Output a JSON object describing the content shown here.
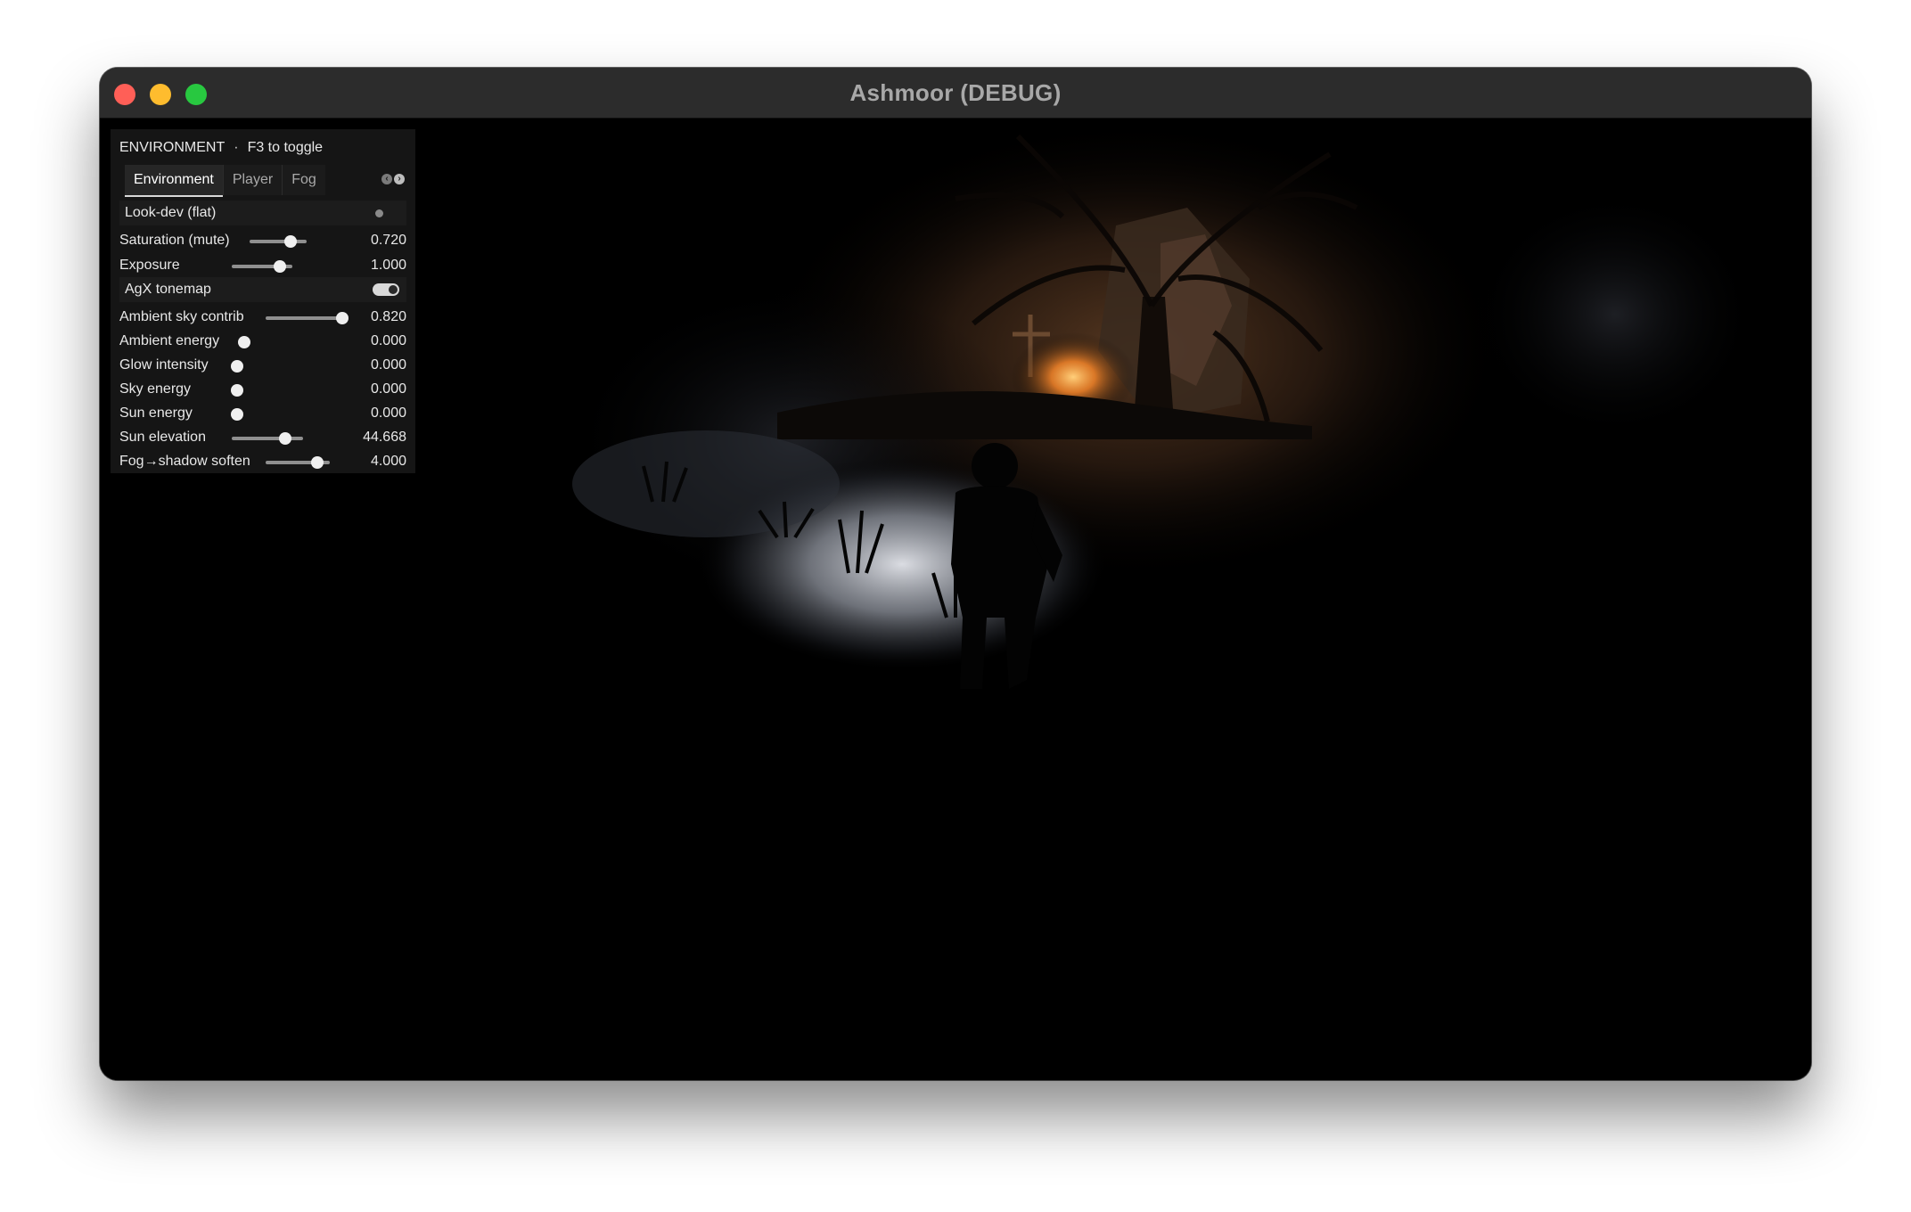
{
  "window": {
    "title": "Ashmoor (DEBUG)"
  },
  "panel": {
    "header": "ENVIRONMENT",
    "separator": "·",
    "hint": "F3 to toggle",
    "tabs": [
      "Environment",
      "Player",
      "Fog"
    ],
    "active_tab": "Environment",
    "rows": {
      "lookdev": {
        "label": "Look-dev (flat)",
        "checked": false
      },
      "saturation": {
        "label": "Saturation (mute)",
        "value": "0.720",
        "fraction": 0.72
      },
      "exposure": {
        "label": "Exposure",
        "value": "1.000",
        "fraction": 0.8
      },
      "agx": {
        "label": "AgX tonemap",
        "enabled": true
      },
      "ambient_sky": {
        "label": "Ambient sky contrib",
        "value": "0.820",
        "fraction": 1.0
      },
      "ambient_energy": {
        "label": "Ambient energy",
        "value": "0.000",
        "fraction": 0.0
      },
      "glow": {
        "label": "Glow intensity",
        "value": "0.000",
        "fraction": 0.0
      },
      "sky_energy": {
        "label": "Sky energy",
        "value": "0.000",
        "fraction": 0.0
      },
      "sun_energy": {
        "label": "Sun energy",
        "value": "0.000",
        "fraction": 0.0
      },
      "sun_elevation": {
        "label": "Sun elevation",
        "value": "44.668",
        "fraction": 0.75
      },
      "fog_soften": {
        "label": "Fog→shadow soften",
        "value": "4.000",
        "fraction": 0.8
      }
    }
  },
  "colors": {
    "traffic_close": "#ff5f57",
    "traffic_minimize": "#febc2e",
    "traffic_zoom": "#28c840",
    "panel_bg": "#161616",
    "torch_glow": "#ff9a3c"
  }
}
